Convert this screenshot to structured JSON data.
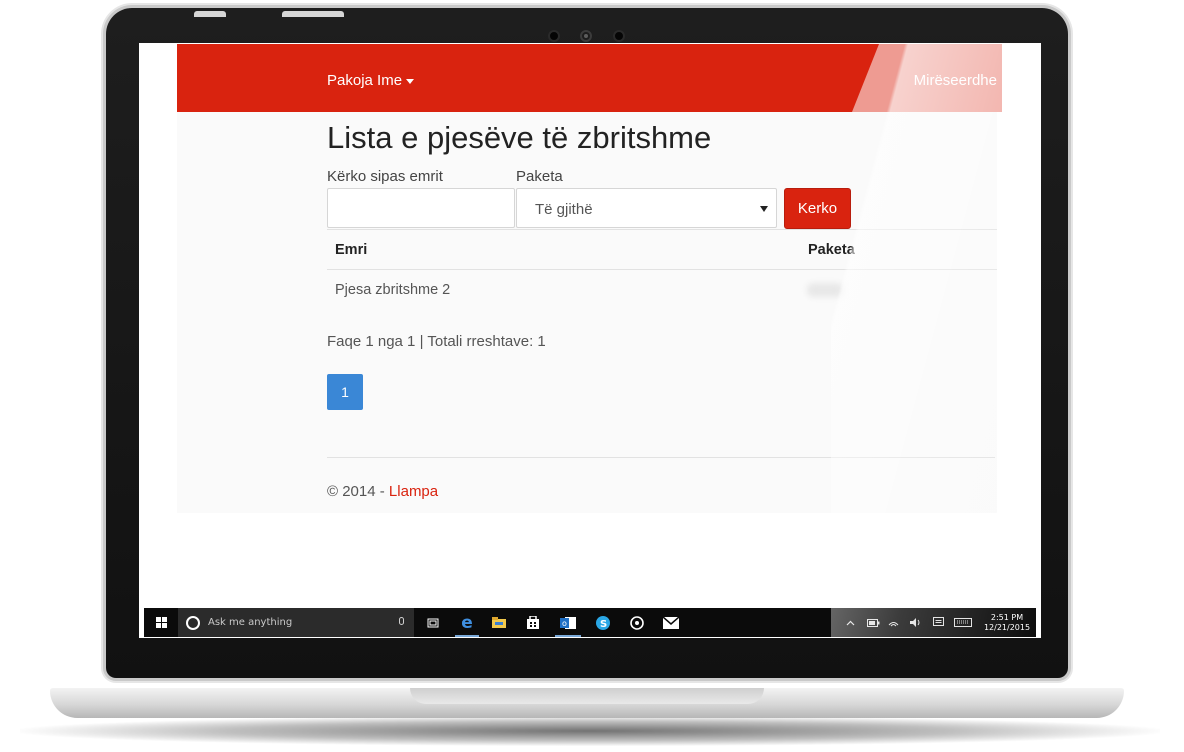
{
  "navbar": {
    "brand": "Pakoja Ime",
    "welcome": "Mirëseerdhe"
  },
  "page": {
    "title": "Lista e pjesëve të zbritshme"
  },
  "search": {
    "name_label": "Kërko sipas emrit",
    "name_value": "",
    "package_label": "Paketa",
    "package_selected": "Të gjithë",
    "button_label": "Kerko"
  },
  "table": {
    "headers": [
      "Emri",
      "Paketa"
    ],
    "rows": [
      [
        "Pjesa zbritshme 2",
        ""
      ]
    ]
  },
  "pagination": {
    "info": "Faqe 1 nga 1 | Totali rreshtave: 1",
    "pages": [
      "1"
    ],
    "current": "1"
  },
  "footer": {
    "copyright": "© 2014 - ",
    "link": "Llampa"
  },
  "taskbar": {
    "search_placeholder": "Ask me anything",
    "time": "2:51 PM",
    "date": "12/21/2015",
    "apps": [
      "task-view-icon",
      "edge-icon",
      "file-explorer-icon",
      "store-icon",
      "outlook-icon",
      "skype-icon",
      "groove-music-icon",
      "mail-icon"
    ]
  },
  "colors": {
    "brand": "#d9230f",
    "page_button": "#3a87d6",
    "taskbar": "#0b0b0b"
  }
}
